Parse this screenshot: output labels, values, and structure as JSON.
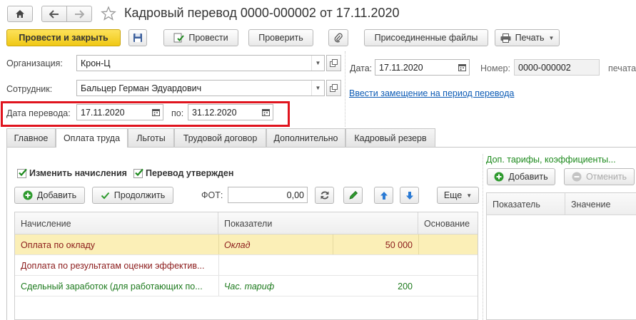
{
  "window": {
    "title": "Кадровый перевод 0000-000002 от 17.11.2020"
  },
  "toolbar": {
    "post_close": "Провести и закрыть",
    "post": "Провести",
    "check": "Проверить",
    "attached_files": "Присоединенные файлы",
    "print": "Печать"
  },
  "form": {
    "org_label": "Организация:",
    "org_value": "Крон-Ц",
    "employee_label": "Сотрудник:",
    "employee_value": "Бальцер Герман Эдуардович",
    "transfer_date_label": "Дата перевода:",
    "transfer_date_value": "17.11.2020",
    "to_label": "по:",
    "to_value": "31.12.2020",
    "date_label": "Дата:",
    "date_value": "17.11.2020",
    "number_label": "Номер:",
    "number_value": "0000-000002",
    "print_cut": "печата",
    "replacement_link": "Ввести замещение на период перевода"
  },
  "tabs": [
    {
      "label": "Главное"
    },
    {
      "label": "Оплата труда"
    },
    {
      "label": "Льготы"
    },
    {
      "label": "Трудовой договор"
    },
    {
      "label": "Дополнительно"
    },
    {
      "label": "Кадровый резерв"
    }
  ],
  "pay": {
    "change_accruals": "Изменить начисления",
    "transfer_approved": "Перевод утвержден",
    "add": "Добавить",
    "continue": "Продолжить",
    "fot_label": "ФОТ:",
    "fot_value": "0,00",
    "more": "Еще"
  },
  "table": {
    "columns": [
      "Начисление",
      "Показатели",
      "Основание"
    ],
    "rows": [
      {
        "name": "Оплата по окладу",
        "indicator": "Оклад",
        "value": "50 000",
        "color": "#8b1a1a"
      },
      {
        "name": "Доплата по результатам оценки эффектив...",
        "indicator": "",
        "value": "",
        "color": "#8b1a1a"
      },
      {
        "name": "Сдельный заработок (для работающих по...",
        "indicator": "Час. тариф",
        "value": "200",
        "color": "#1d7a1d"
      }
    ]
  },
  "side": {
    "title": "Доп. тарифы, коэффициенты...",
    "add": "Добавить",
    "cancel": "Отменить",
    "col_indicator": "Показатель",
    "col_value": "Значение"
  },
  "colors": {
    "accent_yellow": "#f5cd2a",
    "highlight_red": "#e0141e",
    "link": "#0c5bb5",
    "row_selected": "#fbefb7"
  }
}
